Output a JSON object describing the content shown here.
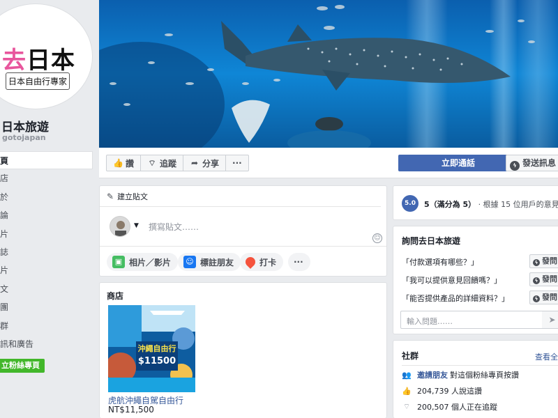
{
  "sidebar": {
    "logo_text_pink": "去",
    "logo_text_main": "日本",
    "logo_subtitle": "日本自由行專家",
    "page_name": "日本旅遊",
    "page_handle": "gotojapan",
    "nav": [
      "頁",
      "店",
      "於",
      "論",
      "片",
      "誌",
      "片",
      "文",
      "團",
      "群",
      "訊和廣告"
    ],
    "create_page_label": "立粉絲專頁"
  },
  "action_bar": {
    "like_label": "讚",
    "follow_label": "追蹤",
    "share_label": "分享",
    "more_label": "···",
    "call_label": "立即通話",
    "message_label": "發送訊息"
  },
  "composer": {
    "header_label": "建立貼文",
    "placeholder": "撰寫貼文……",
    "actions": {
      "photo_video": "相片／影片",
      "tag_friends": "標註朋友",
      "check_in": "打卡",
      "more": "···"
    }
  },
  "shop": {
    "title": "商店",
    "product": {
      "name": "虎航沖繩自駕自由行",
      "price": "NT$11,500",
      "banner_title": "沖繩自由行",
      "banner_price": "$11500"
    }
  },
  "rating": {
    "score": "5.0",
    "score_text": "5（滿分為 5）",
    "based_on": "· 根據 15 位用戶的意見"
  },
  "ask": {
    "title": "詢問去日本旅遊",
    "questions": [
      "「付款選項有哪些？」",
      "「我可以提供意見回饋嗎？」",
      "「能否提供產品的詳細資料？」"
    ],
    "send_label": "發問",
    "input_placeholder": "輸入問題……"
  },
  "community": {
    "title": "社群",
    "see_all": "查看全部",
    "invite_link": "邀請朋友",
    "invite_text": "對這個粉絲專頁按讚",
    "likes_text": "204,739 人說這讚",
    "follows_text": "200,507 個人正在追蹤"
  }
}
